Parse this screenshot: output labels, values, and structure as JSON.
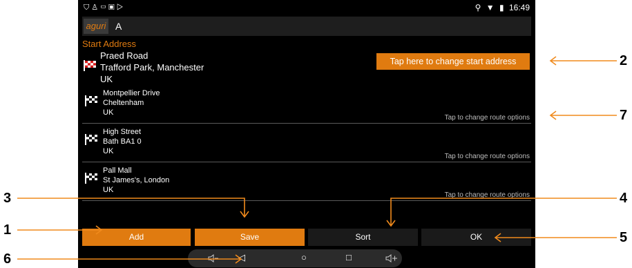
{
  "status_bar": {
    "left_icons": [
      "shield-icon",
      "person-icon",
      "image-icon",
      "lock-icon",
      "play-icon"
    ],
    "right_icons": [
      "location-icon",
      "wifi-icon",
      "battery-icon"
    ],
    "time": "16:49"
  },
  "search": {
    "brand": "aguri",
    "value": "A"
  },
  "start": {
    "section_title": "Start Address",
    "line1": "Praed Road",
    "line2": "Trafford Park, Manchester",
    "line3": "UK",
    "change_label": "Tap here to change start address"
  },
  "destinations": [
    {
      "line1": "Montpellier Drive",
      "line2": "Cheltenham",
      "line3": "UK",
      "route_label": "Tap to change route options"
    },
    {
      "line1": "High Street",
      "line2": "Bath BA1 0",
      "line3": "UK",
      "route_label": "Tap to change route options"
    },
    {
      "line1": "Pall Mall",
      "line2": "St James's, London",
      "line3": "UK",
      "route_label": "Tap to change route options"
    }
  ],
  "buttons": {
    "add": "Add",
    "save": "Save",
    "sort": "Sort",
    "ok": "OK"
  },
  "nav_bar": {
    "icons": [
      "volume-down-icon",
      "back-icon",
      "home-icon",
      "recents-icon",
      "volume-up-icon"
    ],
    "glyphs": [
      "◁",
      "○",
      "□"
    ]
  },
  "callouts": {
    "c1": "1",
    "c2": "2",
    "c3": "3",
    "c4": "4",
    "c5": "5",
    "c6": "6",
    "c7": "7"
  },
  "colors": {
    "accent": "#e07b10",
    "background": "#000000",
    "annotation": "#f08a1c"
  }
}
